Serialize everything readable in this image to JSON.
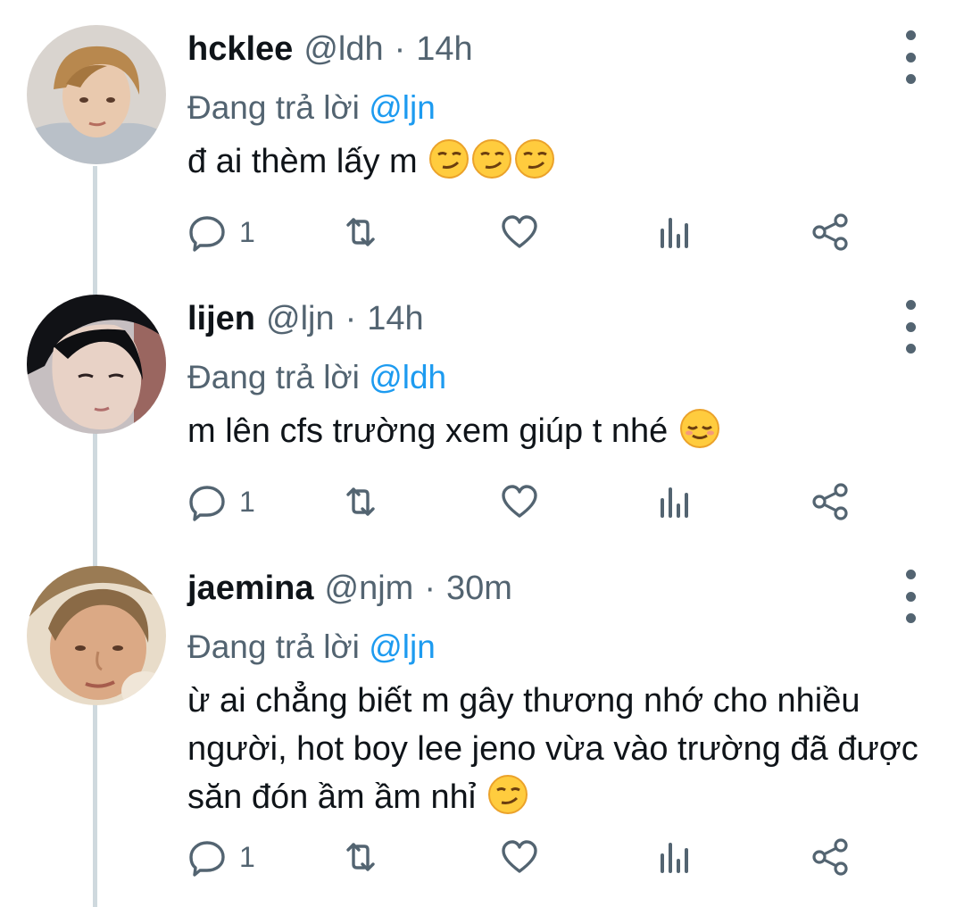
{
  "tweets": [
    {
      "name": "hcklee",
      "handle": "@ldh",
      "sep": "·",
      "time": "14h",
      "reply_prefix": "Đang trả lời",
      "reply_handle": "@ljn",
      "text": "đ ai thèm lấy m",
      "emojis": [
        "smirking-face",
        "smirking-face",
        "smirking-face"
      ],
      "reply_count": "1"
    },
    {
      "name": "lijen",
      "handle": "@ljn",
      "sep": "·",
      "time": "14h",
      "reply_prefix": "Đang trả lời",
      "reply_handle": "@ldh",
      "text": "m lên cfs trường xem giúp t nhé",
      "emojis": [
        "relieved-face"
      ],
      "reply_count": "1"
    },
    {
      "name": "jaemina",
      "handle": "@njm",
      "sep": "·",
      "time": "30m",
      "reply_prefix": "Đang trả lời",
      "reply_handle": "@ljn",
      "text": "ừ ai chẳng biết m gây thương nhớ cho nhiều người, hot boy lee jeno vừa vào trường đã được săn đón ầm ầm nhỉ",
      "emojis": [
        "smirking-face"
      ],
      "reply_count": "1"
    }
  ],
  "icons": {
    "reply": "reply-icon",
    "retweet": "retweet-icon",
    "like": "like-icon",
    "views": "views-icon",
    "share": "share-icon",
    "more": "more-icon"
  },
  "colors": {
    "link": "#1d9bf0",
    "secondary_text": "#536471",
    "thread_line": "#cfd9de"
  }
}
